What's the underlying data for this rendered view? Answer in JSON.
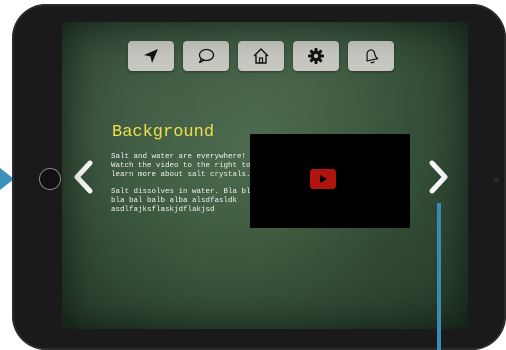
{
  "toolbar": {
    "items": [
      {
        "icon": "location-arrow-icon"
      },
      {
        "icon": "chat-bubble-icon"
      },
      {
        "icon": "home-icon"
      },
      {
        "icon": "gear-icon"
      },
      {
        "icon": "bell-icon"
      }
    ]
  },
  "content": {
    "title": "Background",
    "paragraph_1": "Salt and water are everywhere!  Watch the video to the right to learn more about salt crystals.",
    "paragraph_2": "Salt dissolves in water. Bla bla bla bal balb alba alsdfasldk asdlfajksflaskjdflakjsd"
  },
  "colors": {
    "title": "#ece14a",
    "play_button": "#b0140f",
    "annotation": "#3a8ab8"
  }
}
